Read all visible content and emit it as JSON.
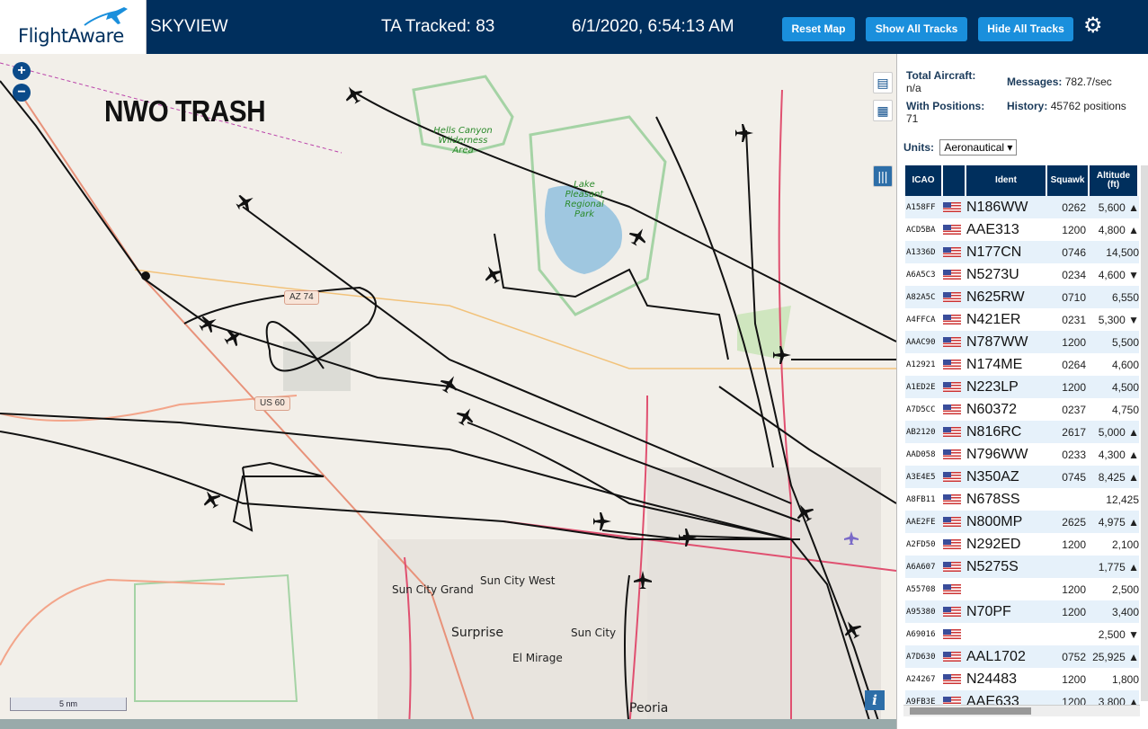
{
  "header": {
    "logo_text": "FlightAware",
    "title": "SKYVIEW",
    "tracked": "TA Tracked: 83",
    "datetime": "6/1/2020, 6:54:13 AM",
    "reset_label": "Reset Map",
    "show_label": "Show All Tracks",
    "hide_label": "Hide All Tracks",
    "settings_icon": "gear-icon"
  },
  "map": {
    "overlay_text": "NWO TRASH",
    "scale": "5 nm",
    "zoom_in": "+",
    "zoom_out": "−",
    "info": "i",
    "labels": {
      "park1": "Hells Canyon Wilderness Area",
      "park2": "Lake Pleasant Regional Park",
      "az74": "AZ 74",
      "us60": "US 60",
      "sun_city_grand": "Sun City Grand",
      "sun_city_west": "Sun City West",
      "surprise": "Surprise",
      "sun_city": "Sun City",
      "el_mirage": "El Mirage",
      "peoria": "Peoria"
    },
    "side_tools": [
      "map-layers-icon",
      "grid-icon",
      "columns-icon"
    ]
  },
  "stats": {
    "total_label": "Total Aircraft:",
    "total_value": "n/a",
    "positions_label": "With Positions:",
    "positions_value": "71",
    "messages_label": "Messages:",
    "messages_value": "782.7/sec",
    "history_label": "History:",
    "history_value": "45762 positions",
    "units_label": "Units:",
    "units_value": "Aeronautical"
  },
  "table": {
    "headers": {
      "icao": "ICAO",
      "ident": "Ident",
      "squawk": "Squawk",
      "altitude": "Altitude (ft)"
    },
    "rows": [
      {
        "icao": "A158FF",
        "ident": "N186WW",
        "squawk": "0262",
        "alt": "5,600 ▲"
      },
      {
        "icao": "ACD5BA",
        "ident": "AAE313",
        "squawk": "1200",
        "alt": "4,800 ▲"
      },
      {
        "icao": "A1336D",
        "ident": "N177CN",
        "squawk": "0746",
        "alt": "14,500"
      },
      {
        "icao": "A6A5C3",
        "ident": "N5273U",
        "squawk": "0234",
        "alt": "4,600 ▼"
      },
      {
        "icao": "A82A5C",
        "ident": "N625RW",
        "squawk": "0710",
        "alt": "6,550"
      },
      {
        "icao": "A4FFCA",
        "ident": "N421ER",
        "squawk": "0231",
        "alt": "5,300 ▼"
      },
      {
        "icao": "AAAC90",
        "ident": "N787WW",
        "squawk": "1200",
        "alt": "5,500"
      },
      {
        "icao": "A12921",
        "ident": "N174ME",
        "squawk": "0264",
        "alt": "4,600"
      },
      {
        "icao": "A1ED2E",
        "ident": "N223LP",
        "squawk": "1200",
        "alt": "4,500"
      },
      {
        "icao": "A7D5CC",
        "ident": "N60372",
        "squawk": "0237",
        "alt": "4,750"
      },
      {
        "icao": "AB2120",
        "ident": "N816RC",
        "squawk": "2617",
        "alt": "5,000 ▲"
      },
      {
        "icao": "AAD058",
        "ident": "N796WW",
        "squawk": "0233",
        "alt": "4,300 ▲"
      },
      {
        "icao": "A3E4E5",
        "ident": "N350AZ",
        "squawk": "0745",
        "alt": "8,425 ▲"
      },
      {
        "icao": "A8FB11",
        "ident": "N678SS",
        "squawk": "",
        "alt": "12,425"
      },
      {
        "icao": "AAE2FE",
        "ident": "N800MP",
        "squawk": "2625",
        "alt": "4,975 ▲"
      },
      {
        "icao": "A2FD50",
        "ident": "N292ED",
        "squawk": "1200",
        "alt": "2,100"
      },
      {
        "icao": "A6A607",
        "ident": "N5275S",
        "squawk": "",
        "alt": "1,775 ▲"
      },
      {
        "icao": "A55708",
        "ident": "",
        "squawk": "1200",
        "alt": "2,500"
      },
      {
        "icao": "A95380",
        "ident": "N70PF",
        "squawk": "1200",
        "alt": "3,400"
      },
      {
        "icao": "A69016",
        "ident": "",
        "squawk": "",
        "alt": "2,500 ▼"
      },
      {
        "icao": "A7D630",
        "ident": "AAL1702",
        "squawk": "0752",
        "alt": "25,925 ▲"
      },
      {
        "icao": "A24267",
        "ident": "N24483",
        "squawk": "1200",
        "alt": "1,800"
      },
      {
        "icao": "A9FB3E",
        "ident": "AAE633",
        "squawk": "1200",
        "alt": "3,800 ▲"
      }
    ]
  },
  "colors": {
    "header_bg": "#002f5d",
    "button_blue": "#1a8fdc",
    "row_alt": "#e6f1fa",
    "track": "#111111"
  }
}
